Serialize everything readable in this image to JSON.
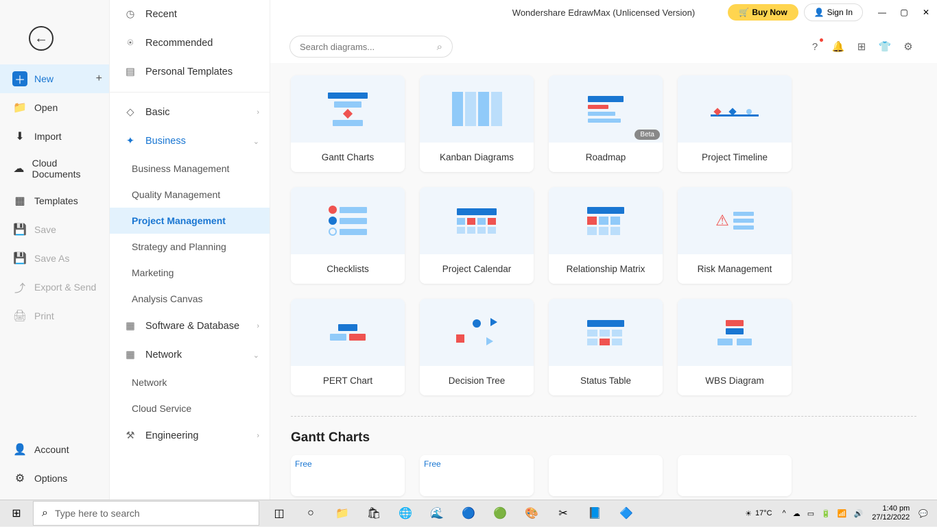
{
  "app": {
    "title": "Wondershare EdrawMax (Unlicensed Version)",
    "buy_label": "Buy Now",
    "signin_label": "Sign In"
  },
  "search": {
    "placeholder": "Search diagrams..."
  },
  "nav_left": {
    "new": "New",
    "open": "Open",
    "import": "Import",
    "cloud_docs": "Cloud Documents",
    "templates": "Templates",
    "save": "Save",
    "save_as": "Save As",
    "export_send": "Export & Send",
    "print": "Print",
    "account": "Account",
    "options": "Options"
  },
  "categories": {
    "recent": "Recent",
    "recommended": "Recommended",
    "personal_templates": "Personal Templates",
    "basic": "Basic",
    "business": "Business",
    "software_db": "Software & Database",
    "network": "Network",
    "engineering": "Engineering"
  },
  "business_sub": {
    "bus_mgmt": "Business Management",
    "quality_mgmt": "Quality Management",
    "proj_mgmt": "Project Management",
    "strategy": "Strategy and Planning",
    "marketing": "Marketing",
    "analysis": "Analysis Canvas"
  },
  "network_sub": {
    "network": "Network",
    "cloud_svc": "Cloud Service"
  },
  "templates": [
    {
      "label": "Gantt Charts",
      "badge": ""
    },
    {
      "label": "Kanban Diagrams",
      "badge": ""
    },
    {
      "label": "Roadmap",
      "badge": "Beta"
    },
    {
      "label": "Project Timeline",
      "badge": ""
    },
    {
      "label": "Checklists",
      "badge": ""
    },
    {
      "label": "Project Calendar",
      "badge": ""
    },
    {
      "label": "Relationship Matrix",
      "badge": ""
    },
    {
      "label": "Risk Management",
      "badge": ""
    },
    {
      "label": "PERT Chart",
      "badge": ""
    },
    {
      "label": "Decision Tree",
      "badge": ""
    },
    {
      "label": "Status Table",
      "badge": ""
    },
    {
      "label": "WBS Diagram",
      "badge": ""
    }
  ],
  "section": {
    "gantt_title": "Gantt Charts",
    "free_label": "Free"
  },
  "taskbar": {
    "search_placeholder": "Type here to search",
    "temp": "17°C",
    "time": "1:40 pm",
    "date": "27/12/2022"
  }
}
